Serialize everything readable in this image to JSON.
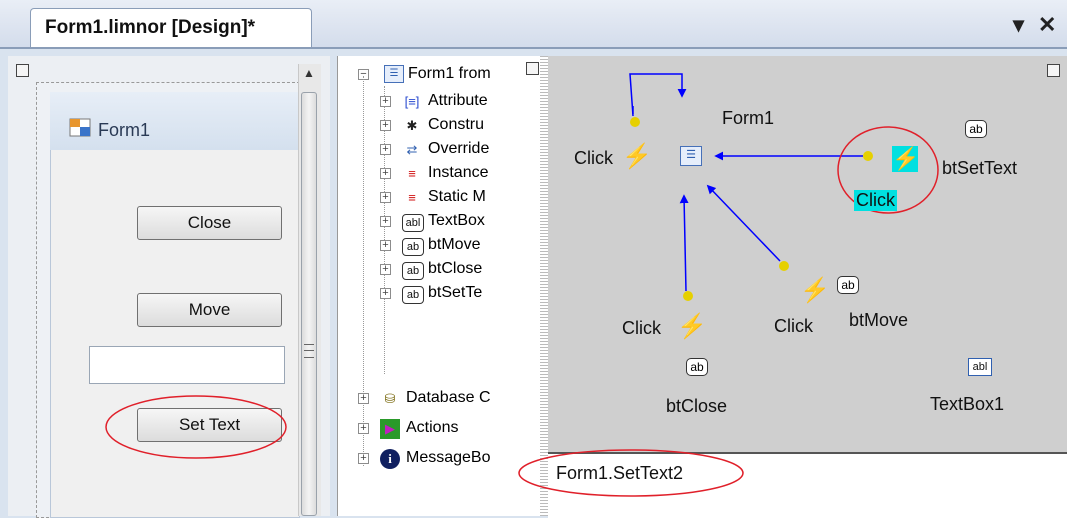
{
  "window": {
    "tab_title": "Form1.limnor [Design]*",
    "dropdown_glyph": "▾",
    "close_glyph": "✕"
  },
  "designer": {
    "form_title": "Form1",
    "buttons": {
      "close": "Close",
      "move": "Move",
      "set_text": "Set Text"
    },
    "textbox_value": ""
  },
  "tree": {
    "root": "Form1 from",
    "items": [
      {
        "label": "Attribute",
        "icon": "attribute-icon"
      },
      {
        "label": "Constru",
        "icon": "constructor-icon"
      },
      {
        "label": "Override",
        "icon": "override-icon"
      },
      {
        "label": "Instance",
        "icon": "instance-icon"
      },
      {
        "label": "Static M",
        "icon": "static-method-icon"
      },
      {
        "label": "TextBox",
        "icon": "textbox-icon"
      },
      {
        "label": "btMove",
        "icon": "button-icon"
      },
      {
        "label": "btClose",
        "icon": "button-icon"
      },
      {
        "label": "btSetTe",
        "icon": "button-icon"
      }
    ],
    "top_items": [
      {
        "label": "Database C",
        "icon": "database-icon"
      },
      {
        "label": "Actions",
        "icon": "actions-icon"
      },
      {
        "label": "MessageBo",
        "icon": "info-icon"
      }
    ]
  },
  "diagram": {
    "form_label": "Form1",
    "click": "Click",
    "components": {
      "btSetText": "btSetText",
      "btMove": "btMove",
      "btClose": "btClose",
      "textbox1": "TextBox1"
    },
    "icon_ab": "ab",
    "icon_abl": "abl",
    "highlight_color": "#00e0e0",
    "arrow_color": "#0000ff",
    "annotation_color": "#e0202a"
  },
  "code": {
    "text": "Form1.SetText2"
  }
}
